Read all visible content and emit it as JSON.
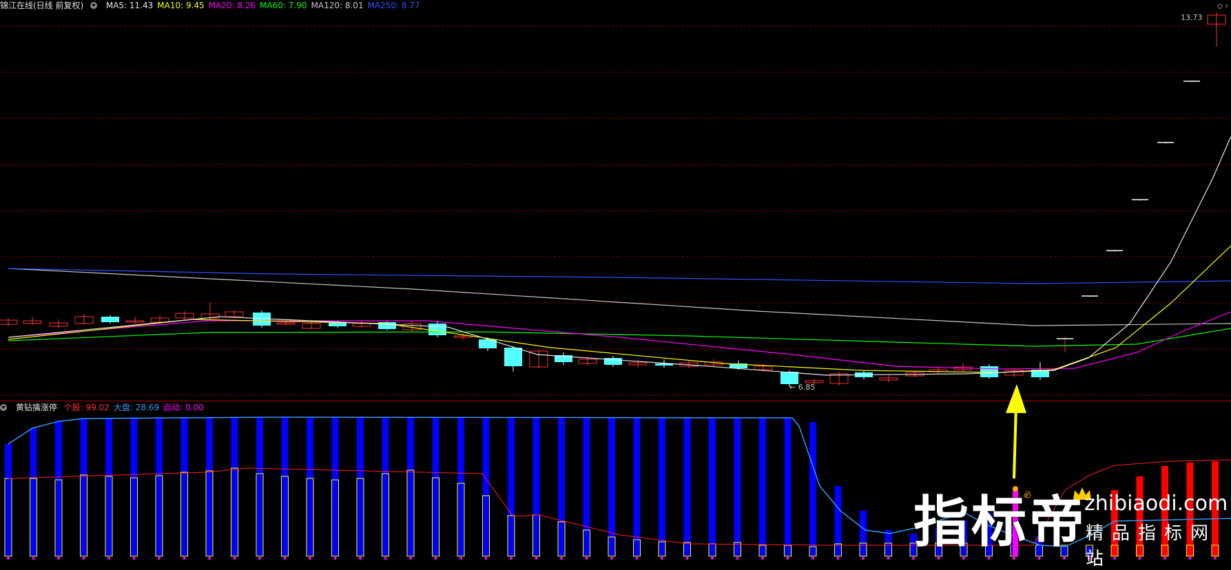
{
  "header": {
    "title": "锦江在线(日线 前复权)",
    "ma": [
      {
        "label": "MA5: 11.43",
        "color": "#e8e8e8"
      },
      {
        "label": "MA10: 9.45",
        "color": "#ffff00"
      },
      {
        "label": "MA20: 8.26",
        "color": "#ff00ff"
      },
      {
        "label": "MA60: 7.90",
        "color": "#00ff00"
      },
      {
        "label": "MA120: 8.01",
        "color": "#c8c8c8"
      },
      {
        "label": "MA250: 8.77",
        "color": "#3050ff"
      }
    ]
  },
  "indicator": {
    "title": "黄钻擒涨停",
    "items": [
      {
        "label": "个股: 99.02",
        "color": "#ff3030"
      },
      {
        "label": "大盘: 28.69",
        "color": "#3399ff"
      },
      {
        "label": "启动: 0.00",
        "color": "#ff00ff"
      }
    ],
    "marker_text": "必"
  },
  "price": {
    "high_label": "13.73",
    "low_label": "← 6.85"
  },
  "watermark": {
    "brand": "指标帝",
    "url": "zhibiaodi.com",
    "sub": "精品指标网站"
  },
  "colors": {
    "bull": "#ff3030",
    "bear": "#54ffff",
    "grid": "#8b0000",
    "blue_bar": "#0000ff",
    "red_bar": "#ff0000",
    "yellow": "#ffff00"
  }
}
